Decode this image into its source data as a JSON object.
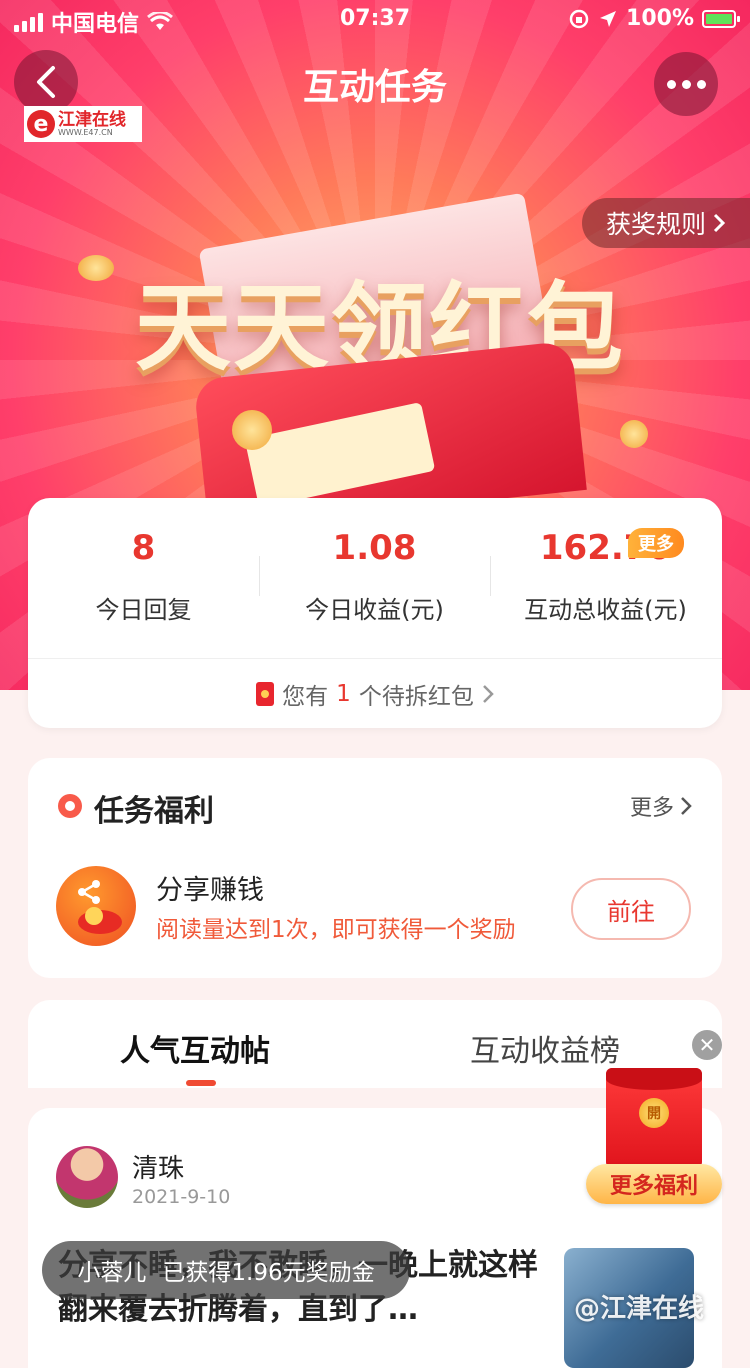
{
  "status_bar": {
    "carrier": "中国电信",
    "time": "07:37",
    "battery": "100%"
  },
  "nav": {
    "title": "互动任务",
    "logo_text": "江津在线",
    "logo_url": "WWW.E47.CN"
  },
  "banner": {
    "title": "天天领红包",
    "rules_label": "获奖规则"
  },
  "stats": {
    "items": [
      {
        "value": "8",
        "label": "今日回复"
      },
      {
        "value": "1.08",
        "label": "今日收益(元)"
      },
      {
        "value": "162.70",
        "label": "互动总收益(元)"
      }
    ],
    "more_badge": "更多",
    "redpack": {
      "prefix": "您有",
      "count": "1",
      "suffix": "个待拆红包"
    }
  },
  "tasks": {
    "title": "任务福利",
    "more_label": "更多",
    "items": [
      {
        "name": "分享赚钱",
        "desc": "阅读量达到1次，即可获得一个奖励",
        "button": "前往"
      }
    ]
  },
  "tabs": {
    "items": [
      "人气互动帖",
      "互动收益榜"
    ],
    "active": 0
  },
  "post": {
    "author": "清珠",
    "date": "2021-9-10",
    "text": "分享不睡，我不敢睡，一晚上就这样翻来覆去折腾着，直到了…"
  },
  "float_redpack": {
    "coin_char": "開",
    "button": "更多福利"
  },
  "toast": {
    "user": "小蓉儿",
    "message": "已获得1.96元奖励金"
  },
  "watermark": "@江津在线",
  "colors": {
    "accent_red": "#e8372f",
    "hero_pink": "#f5285f",
    "badge_orange": "#ff8a1f"
  }
}
